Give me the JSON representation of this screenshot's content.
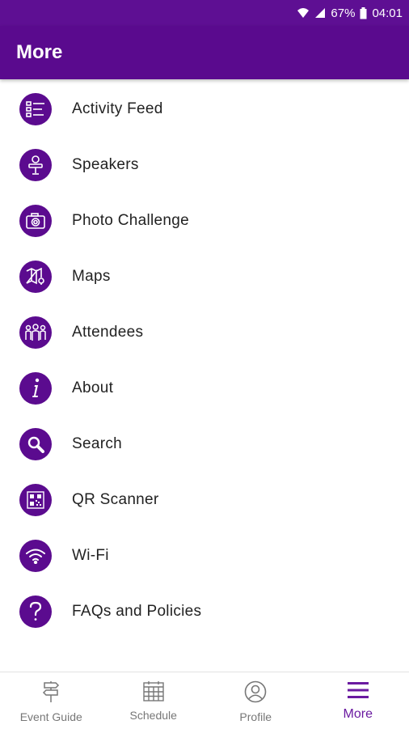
{
  "status_bar": {
    "battery": "67%",
    "time": "04:01"
  },
  "app_bar": {
    "title": "More"
  },
  "menu": [
    {
      "label": "Activity Feed",
      "icon": "activity-feed-icon"
    },
    {
      "label": "Speakers",
      "icon": "speaker-icon"
    },
    {
      "label": "Photo Challenge",
      "icon": "camera-icon"
    },
    {
      "label": "Maps",
      "icon": "map-icon"
    },
    {
      "label": "Attendees",
      "icon": "attendees-icon"
    },
    {
      "label": "About",
      "icon": "info-icon"
    },
    {
      "label": "Search",
      "icon": "search-icon"
    },
    {
      "label": "QR Scanner",
      "icon": "qr-icon"
    },
    {
      "label": "Wi-Fi",
      "icon": "wifi-icon"
    },
    {
      "label": "FAQs and Policies",
      "icon": "question-icon"
    }
  ],
  "tabs": [
    {
      "label": "Event Guide",
      "icon": "signpost-icon"
    },
    {
      "label": "Schedule",
      "icon": "calendar-icon"
    },
    {
      "label": "Profile",
      "icon": "profile-icon"
    },
    {
      "label": "More",
      "icon": "menu-icon",
      "active": true
    }
  ],
  "colors": {
    "primary": "#5a0a8e",
    "status_bar": "#5e0f93",
    "inactive_tab": "#777777",
    "active_tab": "#6a1aa0"
  }
}
